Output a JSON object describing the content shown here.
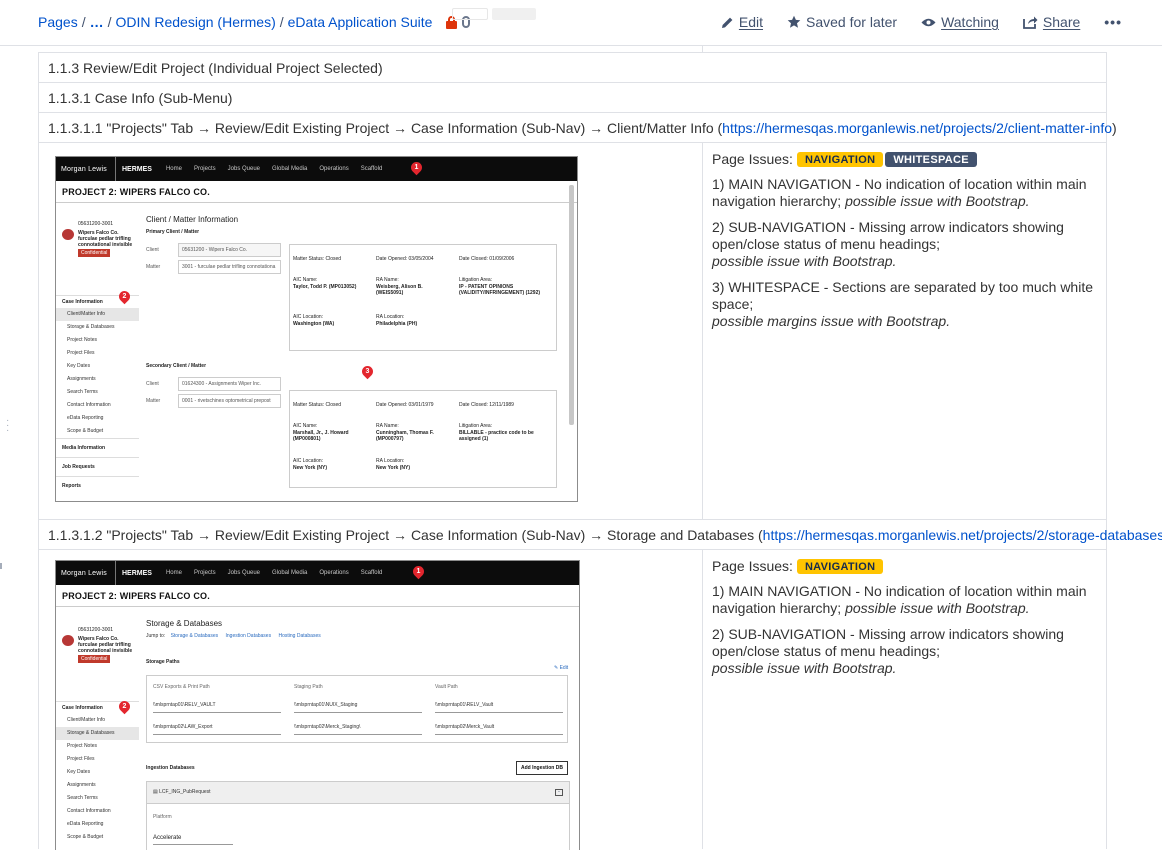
{
  "breadcrumb": {
    "pages": "Pages",
    "sep1": "/",
    "ellipsis": "…",
    "sep2": "/",
    "parent": "ODIN Redesign (Hermes)",
    "sep3": "/",
    "current": "eData Application Suite"
  },
  "actions": {
    "edit": "Edit",
    "saved": "Saved for later",
    "watching": "Watching",
    "share": "Share",
    "more": "•••"
  },
  "rows": {
    "r113": "1.1.3   Review/Edit Project (Individual Project Selected)",
    "r1131": "1.1.3.1   Case Info (Sub-Menu)",
    "r11311_text": "1.1.3.1.1   \"Projects\" Tab → Review/Edit Existing Project → Case Information (Sub-Nav) → Client/Matter Info (",
    "r11311_link": "https://hermesqas.morganlewis.net/projects/2/client-matter-info",
    "r11311_close": ")",
    "r11312_text": "1.1.3.1.2   \"Projects\" Tab → Review/Edit Existing Project → Case Information (Sub-Nav) → Storage and Databases (",
    "r11312_link": "https://hermesqas.morganlewis.net/projects/2/storage-databases",
    "r11312_close": ")"
  },
  "issues1": {
    "label": "Page Issues:",
    "lozenges": [
      "NAVIGATION",
      "WHITESPACE"
    ],
    "i1_plain": "1) MAIN NAVIGATION - No indication of location within main navigation hierarchy; ",
    "i1_em": "possible issue with Bootstrap.",
    "i2_plain": "2) SUB-NAVIGATION - Missing arrow indicators showing open/close status of menu headings;",
    "i2_em": "possible issue with Bootstrap.",
    "i3_plain": "3) WHITESPACE - Sections are separated by too much white space;",
    "i3_em": "possible margins issue with Bootstrap."
  },
  "issues2": {
    "label": "Page Issues:",
    "lozenges": [
      "NAVIGATION"
    ],
    "i1_plain": "1) MAIN NAVIGATION - No indication of location within main navigation hierarchy; ",
    "i1_em": "possible issue with Bootstrap.",
    "i2_plain": "2) SUB-NAVIGATION - Missing arrow indicators showing open/close status of menu headings;",
    "i2_em": "possible issue with Bootstrap."
  },
  "mock": {
    "logo": "Morgan Lewis",
    "hermes": "HERMES",
    "nav": [
      "Home",
      "Projects",
      "Jobs Queue",
      "Global Media",
      "Operations",
      "Scaffold"
    ],
    "project_title": "PROJECT 2: WIPERS FALCO CO.",
    "card_id": "05631200-3001",
    "card_client": "Wipers Falco Co.",
    "card_matter": "furculae pedlar trifling connotational invisible",
    "card_conf": "Confidential",
    "side_head1": "Case Information",
    "side_items": [
      "Client/Matter Info",
      "Storage & Databases",
      "Project Notes",
      "Project Files",
      "Key Dates",
      "Assignments",
      "Search Terms",
      "Contact Information",
      "eData Reporting",
      "Scope & Budget"
    ],
    "side_head2": "Media Information",
    "side_head3": "Job Requests",
    "side_head4": "Reports",
    "pins": [
      "1",
      "2",
      "3"
    ],
    "cm_title": "Client / Matter Information",
    "primary": "Primary Client / Matter",
    "client_label": "Client",
    "client_val": "05631200 - Wipers Falco Co.",
    "matter_label": "Matter",
    "matter_val": "3001 - furculae pedlar trifling connotationa",
    "box1": {
      "status": "Matter Status: Closed",
      "opened": "Date Opened: 03/05/2004",
      "closed": "Date Closed: 01/09/2006",
      "aic_l": "AIC Name:",
      "aic": "Taylor, Todd P. (MP013052)",
      "ra_l": "RA Name:",
      "ra": "Weisberg, Alison B. (WEIS5091)",
      "lit_l": "Litigation Area:",
      "lit": "IP - PATENT OPINIONS (VALIDITY/INFRINGEMENT) (1292)",
      "aicloc_l": "AIC Location:",
      "aicloc": "Washington (WA)",
      "raloc_l": "RA Location:",
      "raloc": "Philadelphia (PH)"
    },
    "secondary": "Secondary Client / Matter",
    "client2_val": "01624300 - Assignments Wiper Inc.",
    "matter2_val": "0001 - rivetschines optometrical prepost",
    "box2": {
      "status": "Matter Status: Closed",
      "opened": "Date Opened: 03/01/1979",
      "closed": "Date Closed: 12/11/1989",
      "aic_l": "AIC Name:",
      "aic": "Marshall, Jr., J. Howard (MP000801)",
      "ra_l": "RA Name:",
      "ra": "Cunningham, Thomas F. (MP000797)",
      "lit_l": "Litigation Area:",
      "lit": "BILLABLE - practice code to be assigned (1)",
      "aicloc_l": "AIC Location:",
      "aicloc": "New York (NY)",
      "raloc_l": "RA Location:",
      "raloc": "New York (NY)"
    },
    "sd_title": "Storage & Databases",
    "jump": "Jump to:",
    "jump_links": [
      "Storage & Databases",
      "Ingestion Databases",
      "Hosting Databases"
    ],
    "storage_paths": "Storage Paths",
    "edit": "✎ Edit",
    "col_heads": [
      "CSV Exports & Print Path",
      "Staging Path",
      "Vault Path"
    ],
    "paths_r1": [
      "\\\\mlsprntap01\\RELV_VAULT",
      "\\\\mlsprntap01\\NUIX_Staging",
      "\\\\mlsprntap01\\RELV_Vault"
    ],
    "paths_r2": [
      "\\\\mlsprntap02\\LAW_Export",
      "\\\\mlsprntap02\\Merck_Staging\\",
      "\\\\mlsprntap02\\Merck_Vault"
    ],
    "ingest": "Ingestion Databases",
    "add_ingest": "Add Ingestion DB",
    "acc_title": "LCF_ING_PubRequest",
    "platform": "Platform",
    "accelerate": "Accelerate"
  },
  "colors": {
    "link": "#0052cc",
    "lozenge_yellow": "#ffc400",
    "lozenge_blue": "#42526e",
    "pin_red": "#e3262e"
  }
}
